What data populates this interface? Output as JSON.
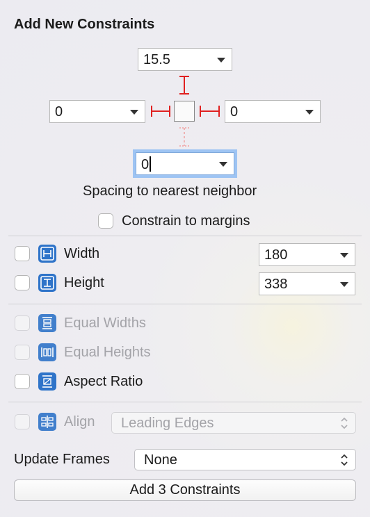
{
  "popover": {
    "title": "Add New Constraints",
    "spacing": {
      "top": "15.5",
      "left": "0",
      "right": "0",
      "bottom": "0",
      "caption": "Spacing to nearest neighbor"
    },
    "constrain_to_margins": {
      "label": "Constrain to margins",
      "checked": false
    },
    "size": {
      "width": {
        "label": "Width",
        "value": "180",
        "checked": false
      },
      "height": {
        "label": "Height",
        "value": "338",
        "checked": false
      }
    },
    "equal": {
      "equal_widths": {
        "label": "Equal Widths",
        "checked": false,
        "enabled": false
      },
      "equal_heights": {
        "label": "Equal Heights",
        "checked": false,
        "enabled": false
      },
      "aspect_ratio": {
        "label": "Aspect Ratio",
        "checked": false,
        "enabled": true
      }
    },
    "align": {
      "label": "Align",
      "value": "Leading Edges",
      "enabled": false
    },
    "update_frames": {
      "label": "Update Frames",
      "value": "None"
    },
    "add_button": {
      "label": "Add 3 Constraints"
    },
    "colors": {
      "accent": "#2f74c9",
      "constraint_red": "#e02020",
      "focus_ring": "#9ec4f3"
    }
  }
}
